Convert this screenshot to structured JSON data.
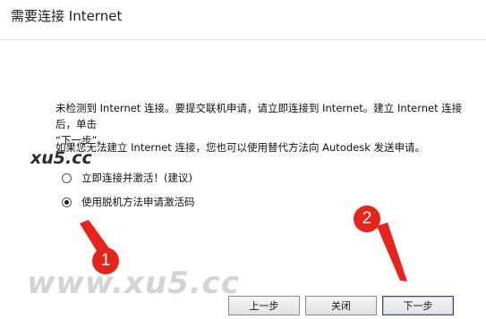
{
  "dialog": {
    "title": "需要连接 Internet",
    "message_line1": "未检测到 Internet 连接。要提交联机申请，请立即连接到 Internet。建立 Internet 连接后，单击",
    "message_line2": "“下一步”。",
    "message_alt": "如果您无法建立 Internet 连接，您也可以使用替代方法向 Autodesk 发送申请。"
  },
  "options": [
    {
      "label": "立即连接并激活！(建议)",
      "selected": false
    },
    {
      "label": "使用脱机方法申请激活码",
      "selected": true
    }
  ],
  "buttons": {
    "back": "上一步",
    "close": "关闭",
    "next": "下一步"
  },
  "annotations": {
    "callout_1": "1",
    "callout_2": "2",
    "color": "#e8231b"
  },
  "watermark": {
    "small": "xu5.cc",
    "large": "www.xu5.cc"
  }
}
